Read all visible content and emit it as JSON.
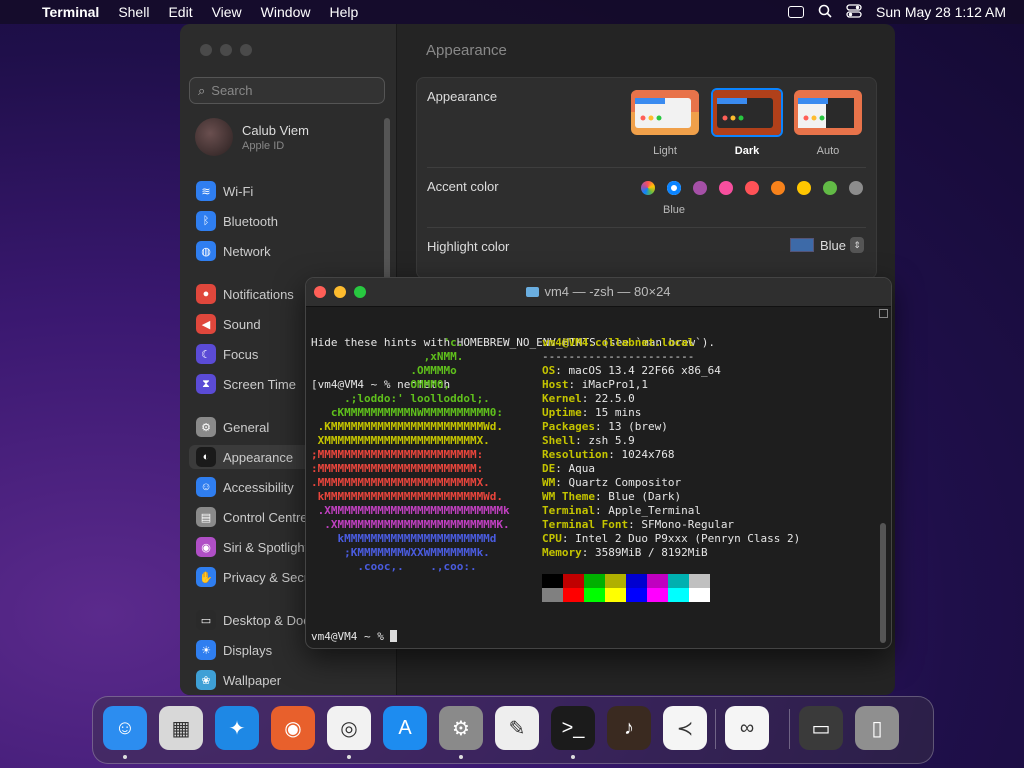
{
  "menubar": {
    "app": "Terminal",
    "items": [
      "Shell",
      "Edit",
      "View",
      "Window",
      "Help"
    ],
    "datetime": "Sun May 28  1:12 AM"
  },
  "settings": {
    "search_placeholder": "Search",
    "profile": {
      "name": "Calub Viem",
      "sub": "Apple ID"
    },
    "sidebar": [
      {
        "label": "Wi-Fi",
        "icon": "wifi-icon",
        "color": "#2f7ef0"
      },
      {
        "label": "Bluetooth",
        "icon": "bluetooth-icon",
        "color": "#2f7ef0"
      },
      {
        "label": "Network",
        "icon": "globe-icon",
        "color": "#2f7ef0"
      },
      {
        "label": "Notifications",
        "icon": "bell-icon",
        "color": "#e0473c"
      },
      {
        "label": "Sound",
        "icon": "speaker-icon",
        "color": "#e0473c"
      },
      {
        "label": "Focus",
        "icon": "moon-icon",
        "color": "#5b4bd6"
      },
      {
        "label": "Screen Time",
        "icon": "hourglass-icon",
        "color": "#5b4bd6"
      },
      {
        "label": "General",
        "icon": "gear-icon",
        "color": "#8a8a8a"
      },
      {
        "label": "Appearance",
        "icon": "appearance-icon",
        "color": "#1a1a1a"
      },
      {
        "label": "Accessibility",
        "icon": "accessibility-icon",
        "color": "#2f7ef0"
      },
      {
        "label": "Control Centre",
        "icon": "control-centre-icon",
        "color": "#8a8a8a"
      },
      {
        "label": "Siri & Spotlight",
        "icon": "siri-icon",
        "color": "#b04fc6"
      },
      {
        "label": "Privacy & Security",
        "icon": "hand-icon",
        "color": "#2f7ef0"
      },
      {
        "label": "Desktop & Dock",
        "icon": "dock-icon",
        "color": "#2a2a2a"
      },
      {
        "label": "Displays",
        "icon": "sun-icon",
        "color": "#2f7ef0"
      },
      {
        "label": "Wallpaper",
        "icon": "wallpaper-icon",
        "color": "#3ea0d6"
      }
    ],
    "main_title": "Appearance",
    "appearance_label": "Appearance",
    "modes": [
      {
        "label": "Light",
        "selected": false
      },
      {
        "label": "Dark",
        "selected": true
      },
      {
        "label": "Auto",
        "selected": false
      }
    ],
    "accent_label": "Accent color",
    "accent_selected": "Blue",
    "accent_colors": [
      "multicolor",
      "#0a84ff",
      "#a550a7",
      "#f74f9e",
      "#ff5257",
      "#f7821b",
      "#ffc600",
      "#62ba46",
      "#8c8c8c"
    ],
    "highlight_label": "Highlight color",
    "highlight_value": "Blue"
  },
  "terminal": {
    "title": "vm4 — -zsh — 80×24",
    "hint_line": "Hide these hints with HOMEBREW_NO_ENV_HINTS (see `man brew`).",
    "prompt1": "[vm4@VM4 ~ % neofetch",
    "logo": [
      {
        "text": "                    'c.",
        "color": "#5fc01c"
      },
      {
        "text": "                 ,xNMM.",
        "color": "#5fc01c"
      },
      {
        "text": "               .OMMMMo",
        "color": "#5fc01c"
      },
      {
        "text": "               OMMM0,",
        "color": "#5fc01c"
      },
      {
        "text": "     .;loddo:' loolloddol;.",
        "color": "#5fc01c"
      },
      {
        "text": "   cKMMMMMMMMMMNWMMMMMMMMMM0:",
        "color": "#5fc01c"
      },
      {
        "text": " .KMMMMMMMMMMMMMMMMMMMMMMMWd.",
        "color": "#c4c400"
      },
      {
        "text": " XMMMMMMMMMMMMMMMMMMMMMMMX.",
        "color": "#c4c400"
      },
      {
        "text": ";MMMMMMMMMMMMMMMMMMMMMMMM:",
        "color": "#e8453c"
      },
      {
        "text": ":MMMMMMMMMMMMMMMMMMMMMMMM:",
        "color": "#e8453c"
      },
      {
        "text": ".MMMMMMMMMMMMMMMMMMMMMMMMX.",
        "color": "#e8453c"
      },
      {
        "text": " kMMMMMMMMMMMMMMMMMMMMMMMMWd.",
        "color": "#e8453c"
      },
      {
        "text": " .XMMMMMMMMMMMMMMMMMMMMMMMMMMk",
        "color": "#c040c0"
      },
      {
        "text": "  .XMMMMMMMMMMMMMMMMMMMMMMMMK.",
        "color": "#c040c0"
      },
      {
        "text": "    kMMMMMMMMMMMMMMMMMMMMMMd",
        "color": "#4a5ce0"
      },
      {
        "text": "     ;KMMMMMMMWXXWMMMMMMMk.",
        "color": "#4a5ce0"
      },
      {
        "text": "       .cooc,.    .,coo:.",
        "color": "#4a5ce0"
      }
    ],
    "host": "vm4@VM4.collabnet.local",
    "separator": "-----------------------",
    "info": [
      {
        "key": "OS",
        "value": "macOS 13.4 22F66 x86_64"
      },
      {
        "key": "Host",
        "value": "iMacPro1,1"
      },
      {
        "key": "Kernel",
        "value": "22.5.0"
      },
      {
        "key": "Uptime",
        "value": "15 mins"
      },
      {
        "key": "Packages",
        "value": "13 (brew)"
      },
      {
        "key": "Shell",
        "value": "zsh 5.9"
      },
      {
        "key": "Resolution",
        "value": "1024x768"
      },
      {
        "key": "DE",
        "value": "Aqua"
      },
      {
        "key": "WM",
        "value": "Quartz Compositor"
      },
      {
        "key": "WM Theme",
        "value": "Blue (Dark)"
      },
      {
        "key": "Terminal",
        "value": "Apple_Terminal"
      },
      {
        "key": "Terminal Font",
        "value": "SFMono-Regular"
      },
      {
        "key": "CPU",
        "value": "Intel 2 Duo P9xxx (Penryn Class 2)"
      },
      {
        "key": "Memory",
        "value": "3589MiB / 8192MiB"
      }
    ],
    "palette_dark": [
      "#000000",
      "#c00000",
      "#00b000",
      "#b0b000",
      "#0000d0",
      "#c000c0",
      "#00b0b0",
      "#c0c0c0"
    ],
    "palette_bright": [
      "#808080",
      "#ff0000",
      "#00ff00",
      "#ffff00",
      "#0000ff",
      "#ff00ff",
      "#00ffff",
      "#ffffff"
    ],
    "prompt2": "vm4@VM4 ~ % "
  },
  "dock": [
    {
      "name": "finder",
      "icon": "finder-icon",
      "color": "#2c8df0",
      "running": true
    },
    {
      "name": "launchpad",
      "icon": "launchpad-icon",
      "color": "#d8d8d8",
      "running": false
    },
    {
      "name": "safari",
      "icon": "safari-icon",
      "color": "#1e88e5",
      "running": false
    },
    {
      "name": "firefox",
      "icon": "firefox-icon",
      "color": "#e8602c",
      "running": false
    },
    {
      "name": "chrome",
      "icon": "chrome-icon",
      "color": "#f2f2f2",
      "running": true
    },
    {
      "name": "app-store",
      "icon": "app-store-icon",
      "color": "#1d8cf0",
      "running": false
    },
    {
      "name": "system-settings",
      "icon": "settings-icon",
      "color": "#8a8a8a",
      "running": true
    },
    {
      "name": "textedit",
      "icon": "textedit-icon",
      "color": "#eeeeee",
      "running": false
    },
    {
      "name": "terminal",
      "icon": "terminal-icon",
      "color": "#1b1b1b",
      "running": true
    },
    {
      "name": "garageband",
      "icon": "guitar-icon",
      "color": "#3a2a20",
      "running": false
    },
    {
      "name": "vscode",
      "icon": "vscode-icon",
      "color": "#f5f5f5",
      "running": false
    },
    {
      "name": "visual-studio",
      "icon": "visual-studio-icon",
      "color": "#f5f5f5",
      "running": false
    },
    {
      "name": "recent-window",
      "icon": "window-thumbnail-icon",
      "color": "#3a3a3a",
      "running": false
    },
    {
      "name": "trash",
      "icon": "trash-icon",
      "color": "#8f8f8f",
      "running": false
    }
  ]
}
